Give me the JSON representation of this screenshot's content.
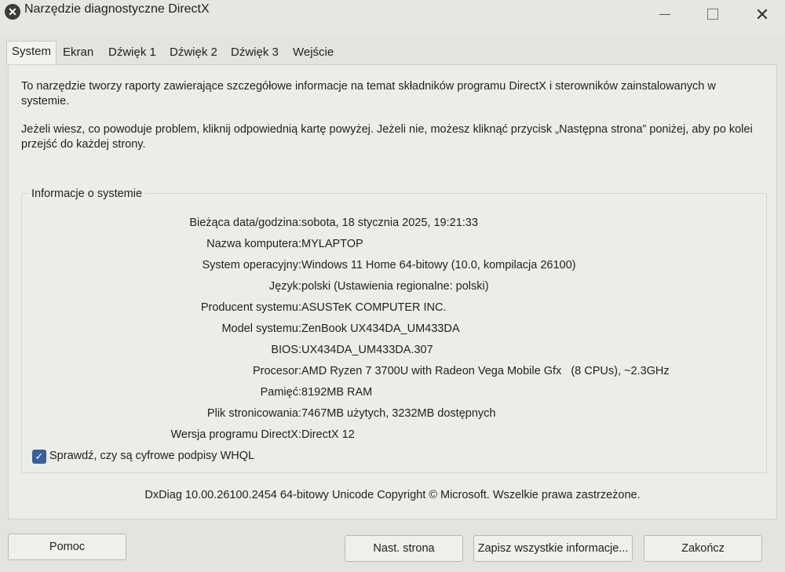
{
  "window": {
    "title": "Narzędzie diagnostyczne DirectX",
    "close_glyph": "✕"
  },
  "tabs": [
    {
      "label": "System",
      "active": true
    },
    {
      "label": "Ekran",
      "active": false
    },
    {
      "label": "Dźwięk 1",
      "active": false
    },
    {
      "label": "Dźwięk 2",
      "active": false
    },
    {
      "label": "Dźwięk 3",
      "active": false
    },
    {
      "label": "Wejście",
      "active": false
    }
  ],
  "intro": {
    "line1": "To narzędzie tworzy raporty zawierające szczegółowe informacje na temat składników programu DirectX i sterowników zainstalowanych w systemie.",
    "line2": "Jeżeli wiesz, co powoduje problem, kliknij odpowiednią kartę powyżej. Jeżeli nie, możesz kliknąć przycisk „Następna strona” poniżej, aby po kolei przejść do każdej strony."
  },
  "system_info": {
    "group_title": "Informacje o systemie",
    "rows": [
      {
        "label": "Bieżąca data/godzina:",
        "value": "sobota, 18 stycznia 2025, 19:21:33"
      },
      {
        "label": "Nazwa komputera:",
        "value": "MYLAPTOP"
      },
      {
        "label": "System operacyjny:",
        "value": "Windows 11 Home 64-bitowy (10.0, kompilacja 26100)"
      },
      {
        "label": "Język:",
        "value": "polski (Ustawienia regionalne: polski)"
      },
      {
        "label": "Producent systemu:",
        "value": "ASUSTeK COMPUTER INC."
      },
      {
        "label": "Model systemu:",
        "value": "ZenBook UX434DA_UM433DA"
      },
      {
        "label": "BIOS:",
        "value": "UX434DA_UM433DA.307"
      },
      {
        "label": "Procesor:",
        "value": "AMD Ryzen 7 3700U with Radeon Vega Mobile Gfx   (8 CPUs), ~2.3GHz"
      },
      {
        "label": "Pamięć:",
        "value": "8192MB RAM"
      },
      {
        "label": "Plik stronicowania:",
        "value": "7467MB użytych, 3232MB dostępnych"
      },
      {
        "label": "Wersja programu DirectX:",
        "value": "DirectX 12"
      }
    ]
  },
  "whql": {
    "label": "Sprawdź, czy są cyfrowe podpisy WHQL",
    "checked": true,
    "check_glyph": "✓"
  },
  "footer_text": "DxDiag 10.00.26100.2454 64-bitowy Unicode  Copyright © Microsoft. Wszelkie prawa zastrzeżone.",
  "buttons": {
    "help": "Pomoc",
    "next": "Nast. strona",
    "save": "Zapisz wszystkie informacje...",
    "exit": "Zakończ"
  }
}
